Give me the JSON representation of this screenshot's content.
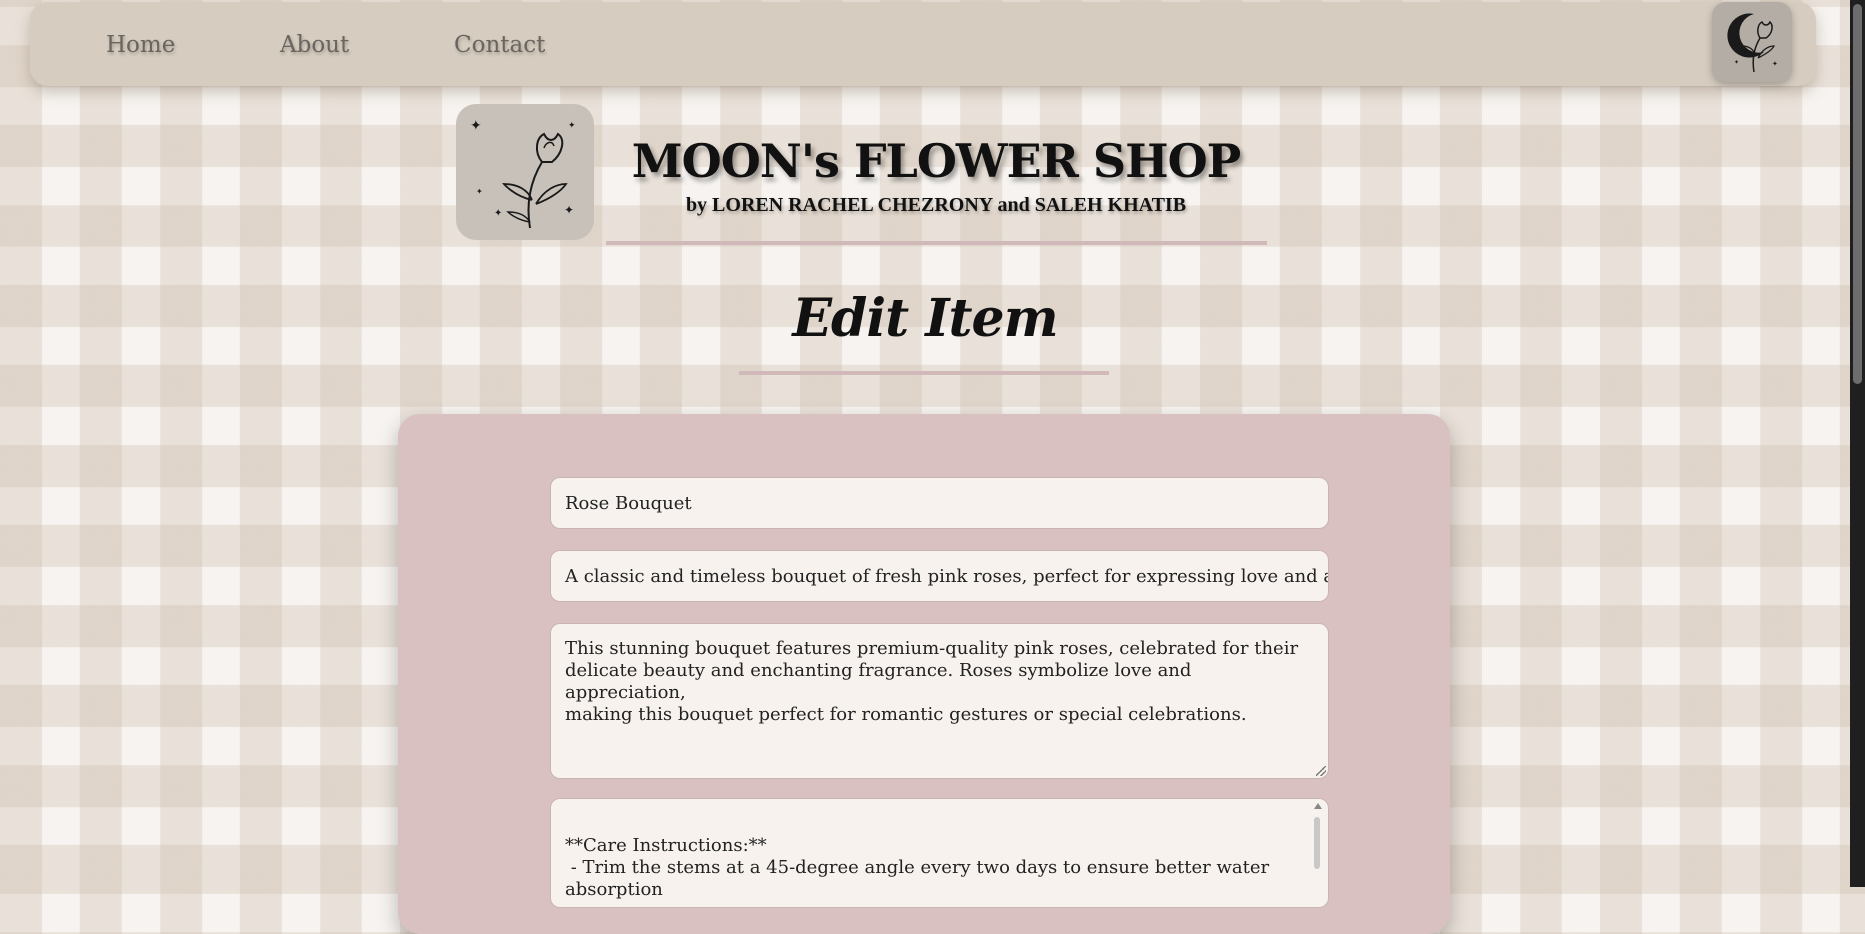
{
  "nav": {
    "links": [
      {
        "label": "Home"
      },
      {
        "label": "About"
      },
      {
        "label": "Contact"
      }
    ],
    "logo_icon": "moon-flower-logo-icon"
  },
  "header": {
    "title": "MOON's FLOWER SHOP",
    "subtitle": "by LOREN RACHEL CHEZRONY and SALEH KHATIB"
  },
  "page": {
    "heading": "Edit Item"
  },
  "form": {
    "name": "Rose Bouquet",
    "short_description": "A classic and timeless bouquet of fresh pink roses, perfect for expressing love and adr",
    "description_lines": [
      "This stunning bouquet features premium-quality pink roses, celebrated for their",
      "delicate beauty and enchanting fragrance. Roses symbolize love and appreciation,",
      "making this bouquet perfect for romantic gestures or special celebrations."
    ],
    "care_lines": [
      "**Care Instructions:**",
      " - Trim the stems at a 45-degree angle every two days to ensure better water",
      "absorption"
    ]
  },
  "colors": {
    "nav_bg": "#d6cdc0",
    "card_bg": "#d9c1c1",
    "field_bg": "#f7f2ed",
    "accent_rule": "#d1b9b9"
  }
}
